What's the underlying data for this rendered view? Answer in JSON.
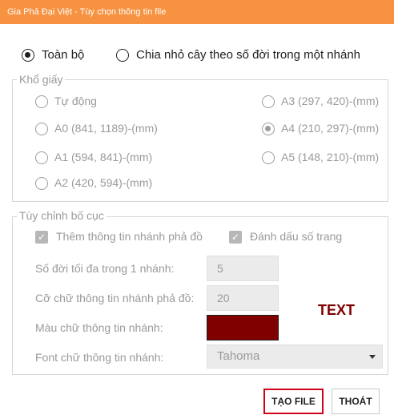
{
  "window": {
    "title": "Gia Phả Đại Việt - Tùy chọn thông tin file"
  },
  "mode": {
    "options": [
      {
        "label": "Toàn bộ",
        "checked": true
      },
      {
        "label": "Chia nhỏ cây theo số đời trong một nhánh",
        "checked": false
      }
    ]
  },
  "paper": {
    "legend": "Khổ giấy",
    "options": [
      {
        "label": "Tự động",
        "checked": false
      },
      {
        "label": "A3 (297, 420)-(mm)",
        "checked": false
      },
      {
        "label": "A0 (841, 1189)-(mm)",
        "checked": false
      },
      {
        "label": "A4 (210, 297)-(mm)",
        "checked": true
      },
      {
        "label": "A1 (594, 841)-(mm)",
        "checked": false
      },
      {
        "label": "A5 (148, 210)-(mm)",
        "checked": false
      },
      {
        "label": "A2 (420, 594)-(mm)",
        "checked": false
      }
    ]
  },
  "layout": {
    "legend": "Tùy chỉnh bố cục",
    "add_branch_info": {
      "label": "Thêm thông tin nhánh phả đồ",
      "checked": true
    },
    "page_numbers": {
      "label": "Đánh dấu số trang",
      "checked": true
    },
    "max_generations": {
      "label": "Số đời tối đa trong 1 nhánh:",
      "value": "5"
    },
    "font_size": {
      "label": "Cỡ chữ thông tin nhánh phả đồ:",
      "value": "20"
    },
    "text_color": {
      "label": "Màu chữ thông tin nhánh:",
      "color": "#800000"
    },
    "font_family": {
      "label": "Font chữ thông tin nhánh:",
      "value": "Tahoma"
    },
    "preview_text": "TEXT"
  },
  "buttons": {
    "create": "TẠO FILE",
    "exit": "THOÁT"
  },
  "colors": {
    "titlebar": "#f69240",
    "accent_red": "#d0021b",
    "preview_text": "#800000"
  }
}
